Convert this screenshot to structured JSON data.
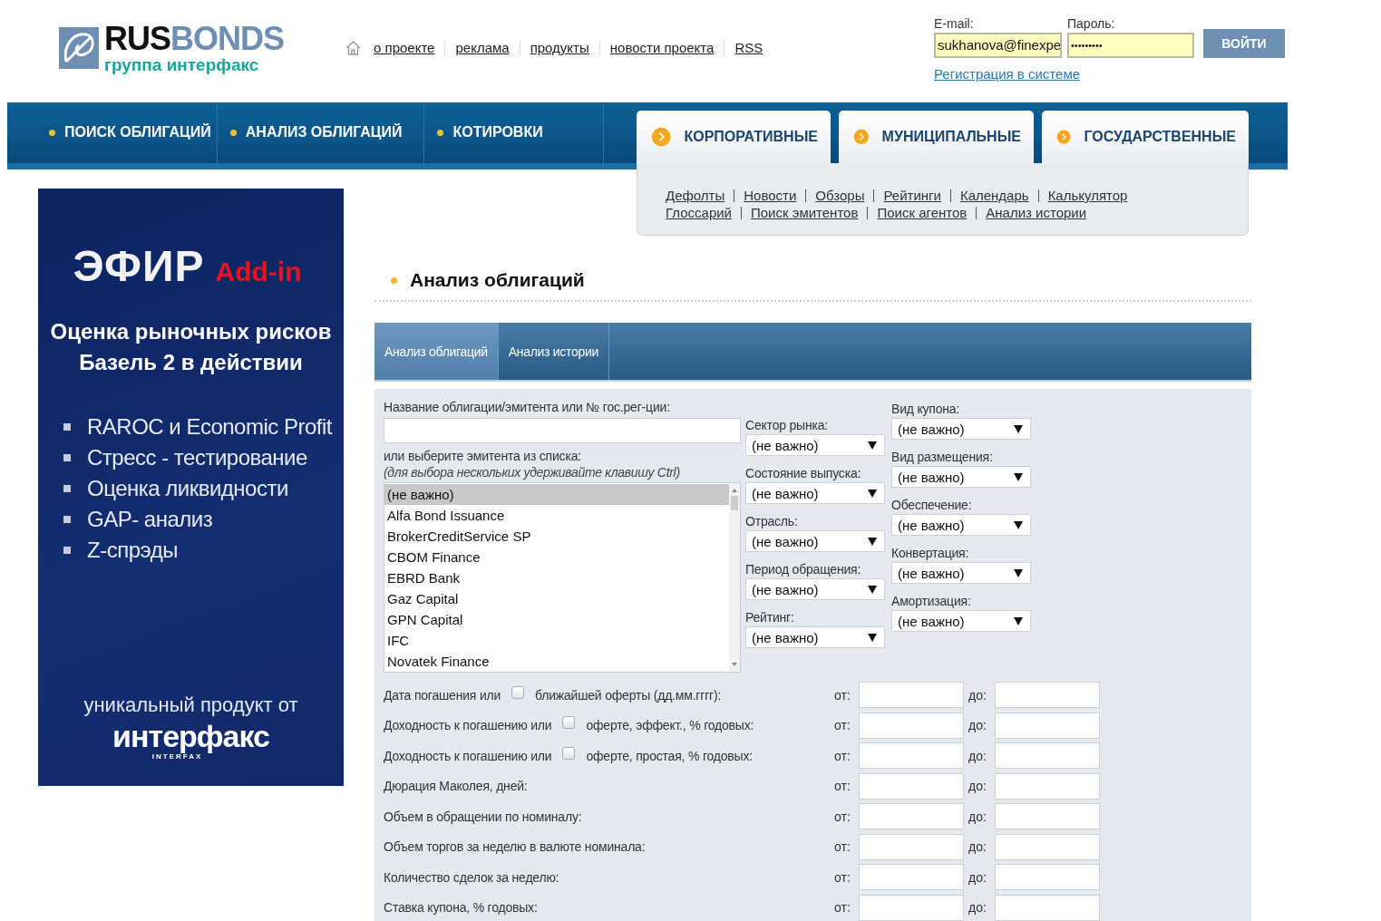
{
  "logo": {
    "brand_a": "RUS",
    "brand_b": "BONDS",
    "tagline": "группа интерфакс"
  },
  "top_links": [
    {
      "label": "о проекте"
    },
    {
      "label": "реклама"
    },
    {
      "label": "продукты"
    },
    {
      "label": "новости проекта"
    },
    {
      "label": "RSS"
    }
  ],
  "login": {
    "email_label": "E-mail:",
    "email_value": "sukhanova@finexpe",
    "password_label": "Пароль:",
    "password_value": "•••••••••",
    "submit": "ВОЙТИ",
    "register": "Регистрация в системе"
  },
  "main_menu": [
    {
      "label": "ПОИСК ОБЛИГАЦИЙ"
    },
    {
      "label": "АНАЛИЗ ОБЛИГАЦИЙ"
    },
    {
      "label": "КОТИРОВКИ"
    }
  ],
  "section_tabs": [
    {
      "label": "КОРПОРАТИВНЫЕ"
    },
    {
      "label": "МУНИЦИПАЛЬНЫЕ"
    },
    {
      "label": "ГОСУДАРСТВЕННЫЕ"
    }
  ],
  "sub_links": [
    [
      "Дефолты",
      "Новости",
      "Обзоры",
      "Рейтинги",
      "Календарь",
      "Калькулятор"
    ],
    [
      "Глоссарий",
      "Поиск эмитентов",
      "Поиск агентов",
      "Анализ истории"
    ]
  ],
  "banner": {
    "title": "ЭФИР",
    "title_badge": "Add-in",
    "subtitle": [
      "Оценка рыночных рисков",
      "Базель 2 в действии"
    ],
    "bullets": [
      "RAROC и Economic Profit",
      "Стресс - тестирование",
      "Оценка ликвидности",
      "GAP- анализ",
      "Z-спрэды"
    ],
    "footer": "уникальный продукт от",
    "brand": "интерфакс",
    "brand_latin": "INTERFAX"
  },
  "page_title": "Анализ облигаций",
  "form_tabs": [
    {
      "label": "Анализ облигаций",
      "selected": true
    },
    {
      "label": "Анализ истории",
      "selected": false
    }
  ],
  "form": {
    "name_label": "Название облигации/эмитента или № гос.рег-ции:",
    "issuer_label": "или выберите эмитента из списка:",
    "issuer_hint": "(для выбора нескольких удерживайте клавишу Ctrl)",
    "issuers": [
      {
        "label": "(не важно)",
        "selected": true
      },
      {
        "label": "Alfa Bond Issuance",
        "selected": false
      },
      {
        "label": "BrokerCreditService SP",
        "selected": false
      },
      {
        "label": "CBOM Finance",
        "selected": false
      },
      {
        "label": "EBRD Bank",
        "selected": false
      },
      {
        "label": "Gaz Capital",
        "selected": false
      },
      {
        "label": "GPN Capital",
        "selected": false
      },
      {
        "label": "IFC",
        "selected": false
      },
      {
        "label": "Novatek Finance",
        "selected": false
      }
    ],
    "selects_middle": [
      {
        "label": "Сектор рынка:",
        "value": "(не важно)"
      },
      {
        "label": "Состояние выпуска:",
        "value": "(не важно)"
      },
      {
        "label": "Отрасль:",
        "value": "(не важно)"
      },
      {
        "label": "Период обращения:",
        "value": "(не важно)"
      },
      {
        "label": "Рейтинг:",
        "value": "(не важно)"
      }
    ],
    "selects_right": [
      {
        "label": "Вид купона:",
        "value": "(не важно)"
      },
      {
        "label": "Вид размещения:",
        "value": "(не важно)"
      },
      {
        "label": "Обеспечение:",
        "value": "(не важно)"
      },
      {
        "label": "Конвертация:",
        "value": "(не важно)"
      },
      {
        "label": "Амортизация:",
        "value": "(не важно)"
      }
    ],
    "ranges": [
      {
        "kind": "checkbox",
        "label": "Дата погашения или",
        "checked": false,
        "label_after": "ближайшей оферты (дд.мм.гггг):",
        "from": "от:",
        "to": "до:"
      },
      {
        "kind": "checkbox",
        "label": "Доходность к погашению или",
        "checked": false,
        "label_after": "оферте, эффект., % годовых:",
        "from": "от:",
        "to": "до:"
      },
      {
        "kind": "checkbox",
        "label": "Доходность к погашению или",
        "checked": false,
        "label_after": "оферте, простая, % годовых:",
        "from": "от:",
        "to": "до:"
      },
      {
        "kind": "plain",
        "label": "Дюрация Маколея, дней:",
        "from": "от:",
        "to": "до:"
      },
      {
        "kind": "plain",
        "label": "Объем в обращении по номиналу:",
        "from": "от:",
        "to": "до:"
      },
      {
        "kind": "plain",
        "label": "Объем торгов за неделю в валюте номинала:",
        "from": "от:",
        "to": "до:"
      },
      {
        "kind": "plain",
        "label": "Количество сделок за неделю:",
        "from": "от:",
        "to": "до:"
      },
      {
        "kind": "plain",
        "label": "Ставка купона, % годовых:",
        "from": "от:",
        "to": "до:"
      }
    ]
  }
}
